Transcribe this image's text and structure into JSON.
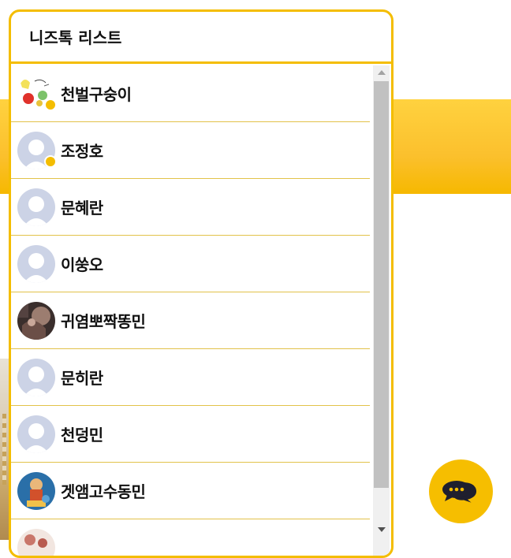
{
  "panel": {
    "title": "니즈톡 리스트"
  },
  "friends": [
    {
      "name": "천벌구숭이",
      "avatar": "cartoon-avatar-icon",
      "online": true
    },
    {
      "name": "조정호",
      "avatar": "default-avatar-icon",
      "online": true
    },
    {
      "name": "문혜란",
      "avatar": "default-avatar-icon",
      "online": false
    },
    {
      "name": "이쑹오",
      "avatar": "default-avatar-icon",
      "online": false
    },
    {
      "name": "귀염뽀짝똥민",
      "avatar": "photo-avatar-icon",
      "online": false
    },
    {
      "name": "문히란",
      "avatar": "default-avatar-icon",
      "online": false
    },
    {
      "name": "천덩민",
      "avatar": "default-avatar-icon",
      "online": false
    },
    {
      "name": "겟앰고수동민",
      "avatar": "illustration-avatar-icon",
      "online": false
    }
  ],
  "colors": {
    "accent": "#f4bd00",
    "band": "#fbc02d",
    "default_avatar": "#ccd3e6"
  }
}
